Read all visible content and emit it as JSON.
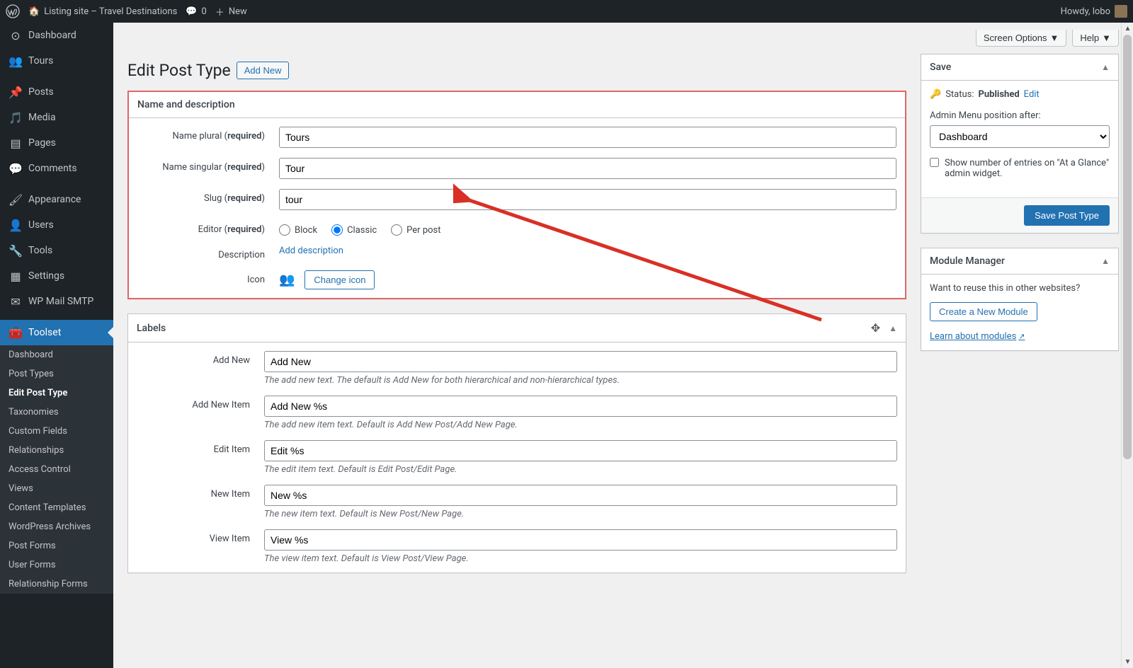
{
  "toolbar": {
    "site_name": "Listing site – Travel Destinations",
    "comments_count": "0",
    "new_label": "New",
    "howdy": "Howdy, lobo"
  },
  "sidebar": {
    "items": [
      {
        "icon": "dashboard",
        "label": "Dashboard"
      },
      {
        "icon": "groups",
        "label": "Tours"
      },
      {
        "icon": "pin",
        "label": "Posts"
      },
      {
        "icon": "media",
        "label": "Media"
      },
      {
        "icon": "page",
        "label": "Pages"
      },
      {
        "icon": "comment",
        "label": "Comments"
      },
      {
        "icon": "appearance",
        "label": "Appearance"
      },
      {
        "icon": "users",
        "label": "Users"
      },
      {
        "icon": "tools",
        "label": "Tools"
      },
      {
        "icon": "settings",
        "label": "Settings"
      },
      {
        "icon": "mail",
        "label": "WP Mail SMTP"
      },
      {
        "icon": "toolset",
        "label": "Toolset"
      }
    ],
    "sub": [
      "Dashboard",
      "Post Types",
      "Edit Post Type",
      "Taxonomies",
      "Custom Fields",
      "Relationships",
      "Access Control",
      "Views",
      "Content Templates",
      "WordPress Archives",
      "Post Forms",
      "User Forms",
      "Relationship Forms"
    ]
  },
  "header": {
    "screen_options": "Screen Options",
    "help": "Help",
    "title": "Edit Post Type",
    "add_new": "Add New"
  },
  "name_box": {
    "title": "Name and description",
    "name_plural_label": "Name plural (",
    "name_plural_req": "required",
    "name_plural_value": "Tours",
    "name_singular_label": "Name singular (",
    "name_singular_req": "required",
    "name_singular_value": "Tour",
    "slug_label": "Slug (",
    "slug_req": "required",
    "slug_value": "tour",
    "editor_label": "Editor (",
    "editor_req": "required",
    "editor_options": [
      "Block",
      "Classic",
      "Per post"
    ],
    "description_label": "Description",
    "add_description": "Add description",
    "icon_label": "Icon",
    "change_icon": "Change icon"
  },
  "labels_box": {
    "title": "Labels",
    "rows": [
      {
        "label": "Add New",
        "value": "Add New",
        "desc": "The add new text. The default is Add New for both hierarchical and non-hierarchical types."
      },
      {
        "label": "Add New Item",
        "value": "Add New %s",
        "desc": "The add new item text. Default is Add New Post/Add New Page."
      },
      {
        "label": "Edit Item",
        "value": "Edit %s",
        "desc": "The edit item text. Default is Edit Post/Edit Page."
      },
      {
        "label": "New Item",
        "value": "New %s",
        "desc": "The new item text. Default is New Post/New Page."
      },
      {
        "label": "View Item",
        "value": "View %s",
        "desc": "The view item text. Default is View Post/View Page."
      }
    ]
  },
  "save_box": {
    "title": "Save",
    "status_label": "Status:",
    "status_value": "Published",
    "edit_link": "Edit",
    "menu_position_label": "Admin Menu position after:",
    "menu_position_value": "Dashboard",
    "show_entries": "Show number of entries on \"At a Glance\" admin widget.",
    "save_button": "Save Post Type"
  },
  "module_box": {
    "title": "Module Manager",
    "reuse_text": "Want to reuse this in other websites?",
    "create_button": "Create a New Module",
    "learn_link": "Learn about modules"
  }
}
